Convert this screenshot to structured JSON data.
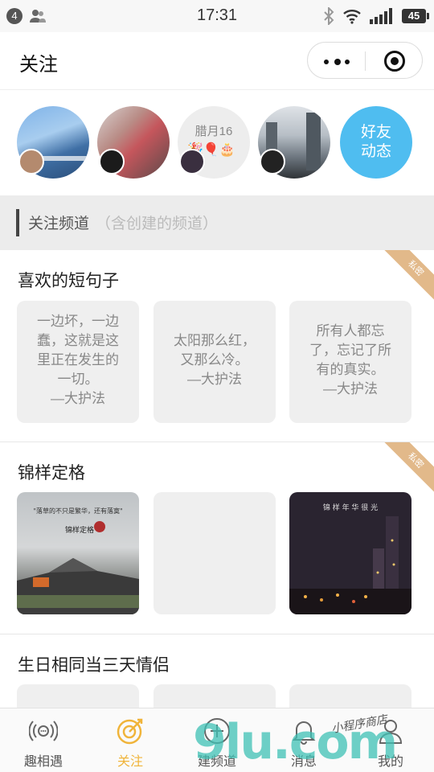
{
  "status_bar": {
    "notification_count": "4",
    "time": "17:31",
    "battery": "45"
  },
  "nav": {
    "title": "关注"
  },
  "avatars": [
    {
      "type": "photo",
      "icon": "avatar-sky-photo"
    },
    {
      "type": "photo",
      "icon": "avatar-girl-photo"
    },
    {
      "type": "birthday",
      "label": "腊月16",
      "emojis": "🎉🎈🎂"
    },
    {
      "type": "photo",
      "icon": "avatar-city-photo"
    },
    {
      "type": "friends",
      "label_line1": "好友",
      "label_line2": "动态"
    }
  ],
  "section": {
    "title": "关注频道",
    "subtitle": "（含创建的频道）"
  },
  "channels": [
    {
      "title": "喜欢的短句子",
      "badge": "私密",
      "cards": [
        "一边坏，一边\n蠢，这就是这\n里正在发生的\n一切。\n—大护法",
        "太阳那么红，\n又那么冷。\n—大护法",
        "所有人都忘\n了，忘记了所\n有的真实。\n—大护法"
      ]
    },
    {
      "title": "锦样定格",
      "badge": "私密",
      "photo1_caption": "\"落草的不只是繁华，还有落寞\"",
      "photo1_brand": "锦样定格",
      "photo2_caption": "锦 样 年 华 很 光"
    },
    {
      "title": "生日相同当三天情侣"
    }
  ],
  "tabs": [
    {
      "label": "趣相遇",
      "icon": "radar-icon",
      "active": false
    },
    {
      "label": "关注",
      "icon": "target-icon",
      "active": true
    },
    {
      "label": "建频道",
      "icon": "add-circle-icon",
      "active": false
    },
    {
      "label": "消息",
      "icon": "bell-icon",
      "active": false
    },
    {
      "label": "我的",
      "icon": "user-icon",
      "active": false
    }
  ],
  "watermark": {
    "logo": "9lu.com",
    "handwriting": "小程序商店"
  },
  "colors": {
    "accent": "#f0b43a",
    "friends_bg": "#4fbdf0",
    "ribbon": "#e2b98a"
  }
}
